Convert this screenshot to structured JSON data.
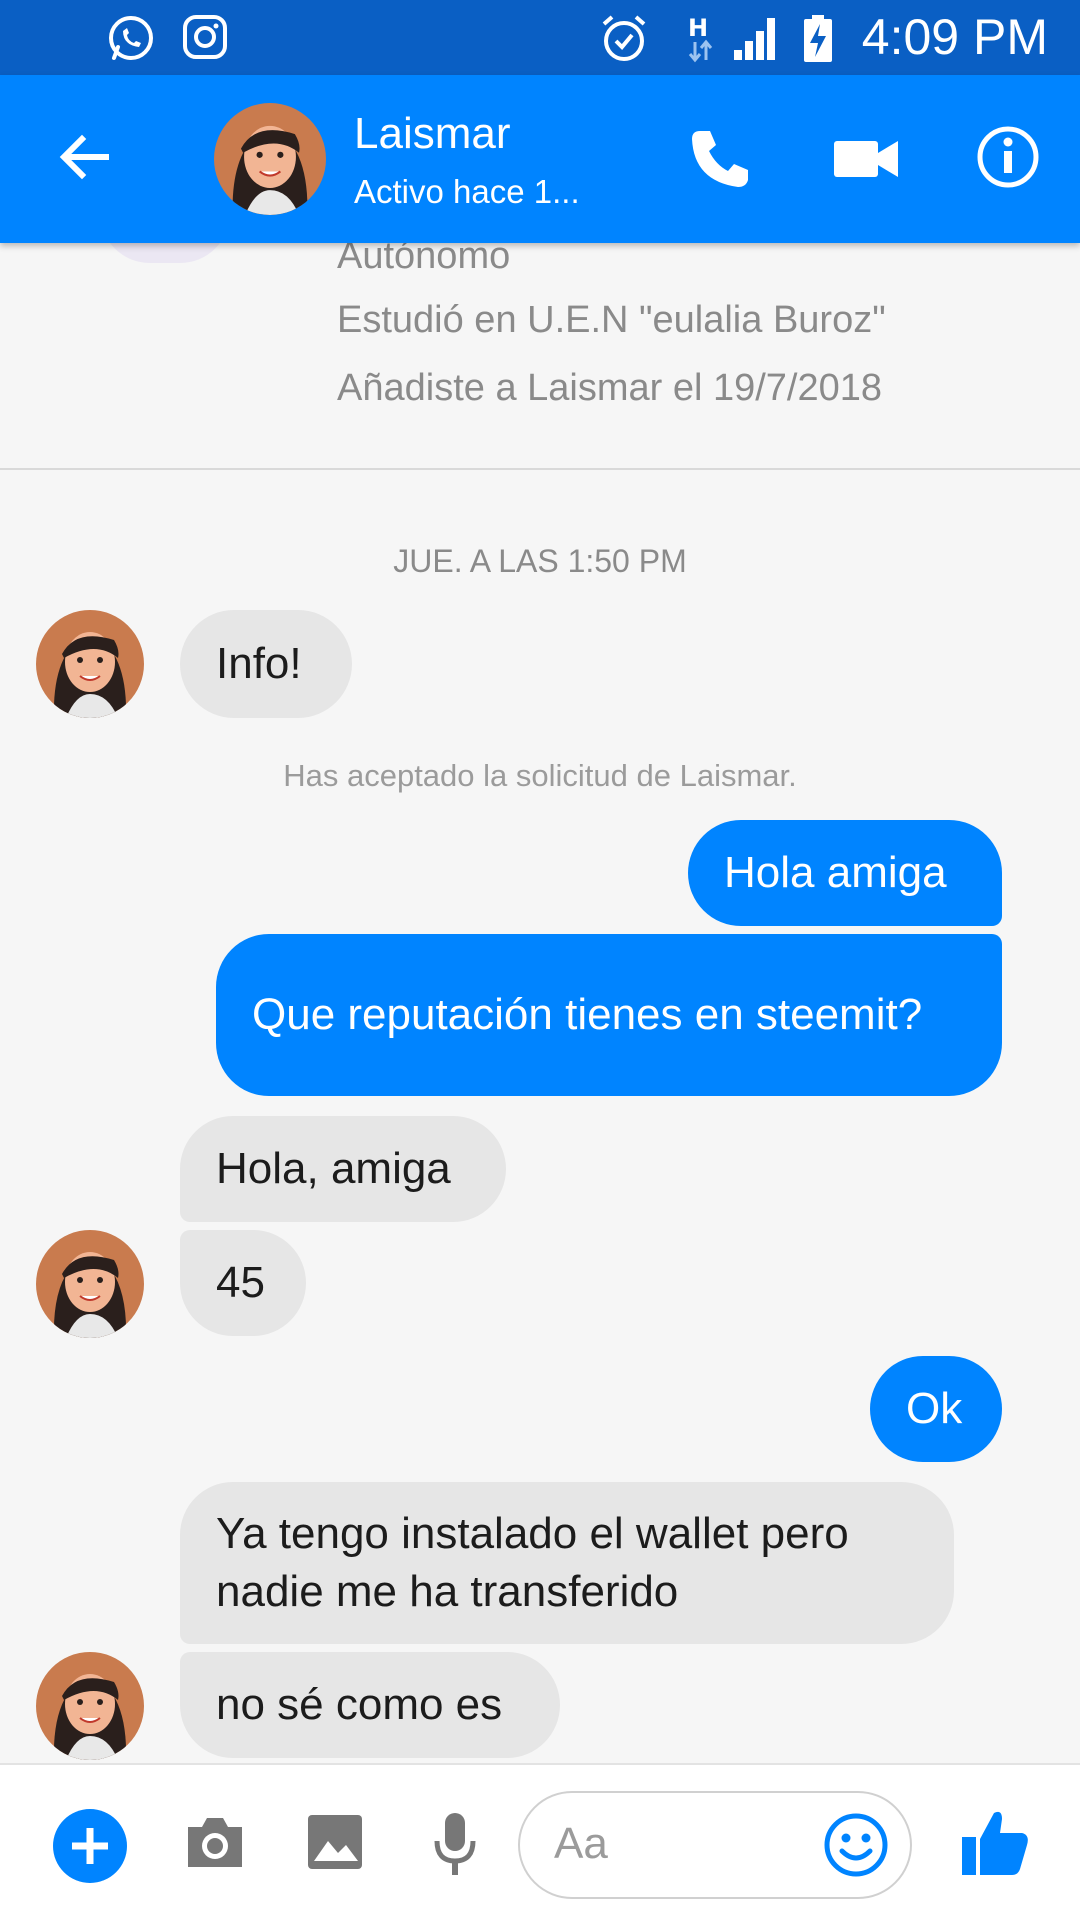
{
  "status_bar": {
    "time": "4:09 PM",
    "left_icons": [
      "whatsapp-icon",
      "instagram-icon"
    ],
    "right_icons": [
      "alarm-icon",
      "network-h-icon",
      "signal-icon",
      "battery-charging-icon"
    ]
  },
  "header": {
    "name": "Laismar",
    "status": "Activo hace 1...",
    "icons": [
      "back-arrow-icon",
      "phone-icon",
      "video-icon",
      "info-icon"
    ]
  },
  "profile_info": {
    "lines": [
      "Autónomo",
      "Estudió en U.E.N \"eulalia Buroz\"",
      "Añadiste a Laismar el 19/7/2018"
    ]
  },
  "conversation": {
    "timestamp": "JUE. A LAS 1:50 PM",
    "system_note": "Has aceptado la solicitud de Laismar.",
    "messages": [
      {
        "from": "them",
        "text": "Info!"
      },
      {
        "from": "me",
        "text": "Hola amiga"
      },
      {
        "from": "me",
        "text": "Que reputación tienes en steemit?"
      },
      {
        "from": "them",
        "text": "Hola, amiga"
      },
      {
        "from": "them",
        "text": "45"
      },
      {
        "from": "me",
        "text": "Ok"
      },
      {
        "from": "them",
        "text": "Ya tengo instalado el wallet pero nadie me ha transferido"
      },
      {
        "from": "them",
        "text": "no sé como es"
      }
    ]
  },
  "composer": {
    "placeholder": "Aa",
    "icons": [
      "plus-icon",
      "camera-icon",
      "gallery-icon",
      "microphone-icon",
      "emoji-icon",
      "thumbs-up-icon"
    ]
  },
  "colors": {
    "status_bar": "#0a5fc4",
    "header": "#0084ff",
    "outgoing_bubble": "#0084ff",
    "incoming_bubble": "#e6e6e6",
    "background": "#f6f6f6"
  }
}
